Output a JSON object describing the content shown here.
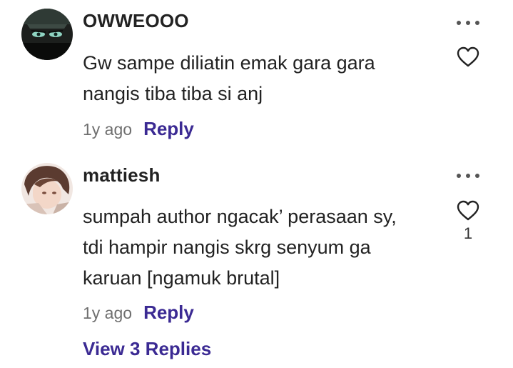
{
  "comments": [
    {
      "username": "OWWEOOO",
      "text": "Gw sampe diliatin emak gara gara nangis tiba tiba si anj",
      "time": "1y ago",
      "reply_label": "Reply",
      "like_count": ""
    },
    {
      "username": "mattiesh",
      "text": "sumpah author ngacak’ perasaan sy, tdi hampir nangis skrg senyum ga karuan [ngamuk brutal]",
      "time": "1y ago",
      "reply_label": "Reply",
      "like_count": "1",
      "view_replies_label": "View 3 Replies"
    }
  ],
  "colors": {
    "accent": "#3b2a93",
    "text": "#222222",
    "muted": "#6f6f6f"
  },
  "icons": {
    "more": "more-horizontal-icon",
    "like": "heart-outline-icon"
  }
}
